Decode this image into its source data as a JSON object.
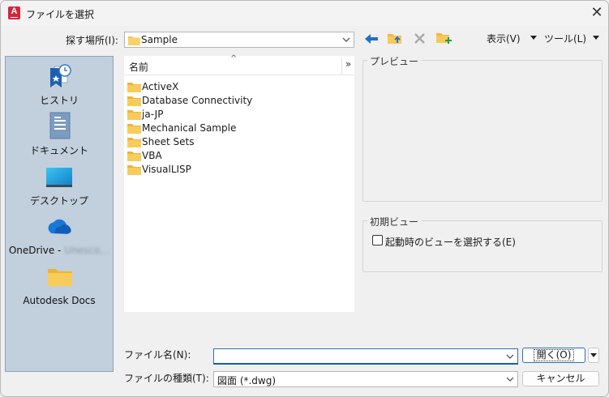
{
  "window": {
    "title": "ファイルを選択",
    "app_logo_letter": "A",
    "close_glyph": "✕"
  },
  "lookin": {
    "label": "探す場所(I):",
    "value": "Sample"
  },
  "toolbar": {
    "view_label": "表示(V)",
    "tools_label": "ツール(L)"
  },
  "places": [
    {
      "label": "ヒストリ",
      "icon": "history-icon"
    },
    {
      "label": "ドキュメント",
      "icon": "documents-icon"
    },
    {
      "label": "デスクトップ",
      "icon": "desktop-icon"
    },
    {
      "label": "OneDrive - ",
      "icon": "onedrive-icon",
      "blurred_suffix": "Unesco…"
    },
    {
      "label": "Autodesk Docs",
      "icon": "autodesk-docs-folder-icon"
    }
  ],
  "filelist": {
    "column_name": "名前",
    "more_glyph": "»",
    "items": [
      "ActiveX",
      "Database Connectivity",
      "ja-JP",
      "Mechanical Sample",
      "Sheet Sets",
      "VBA",
      "VisualLISP"
    ]
  },
  "preview": {
    "title": "プレビュー"
  },
  "initial_view": {
    "title": "初期ビュー",
    "checkbox_label": "起動時のビューを選択する(E)",
    "checked": false
  },
  "filename": {
    "label": "ファイル名(N):",
    "value": ""
  },
  "filetype": {
    "label": "ファイルの種類(T):",
    "value": "図面 (*.dwg)"
  },
  "buttons": {
    "open": "開く(O)",
    "cancel": "キャンセル"
  },
  "colors": {
    "accent": "#0c5fbf",
    "folder": "#f4c24d",
    "places_bg": "#c2cfdc",
    "logo_red": "#d6253a"
  }
}
